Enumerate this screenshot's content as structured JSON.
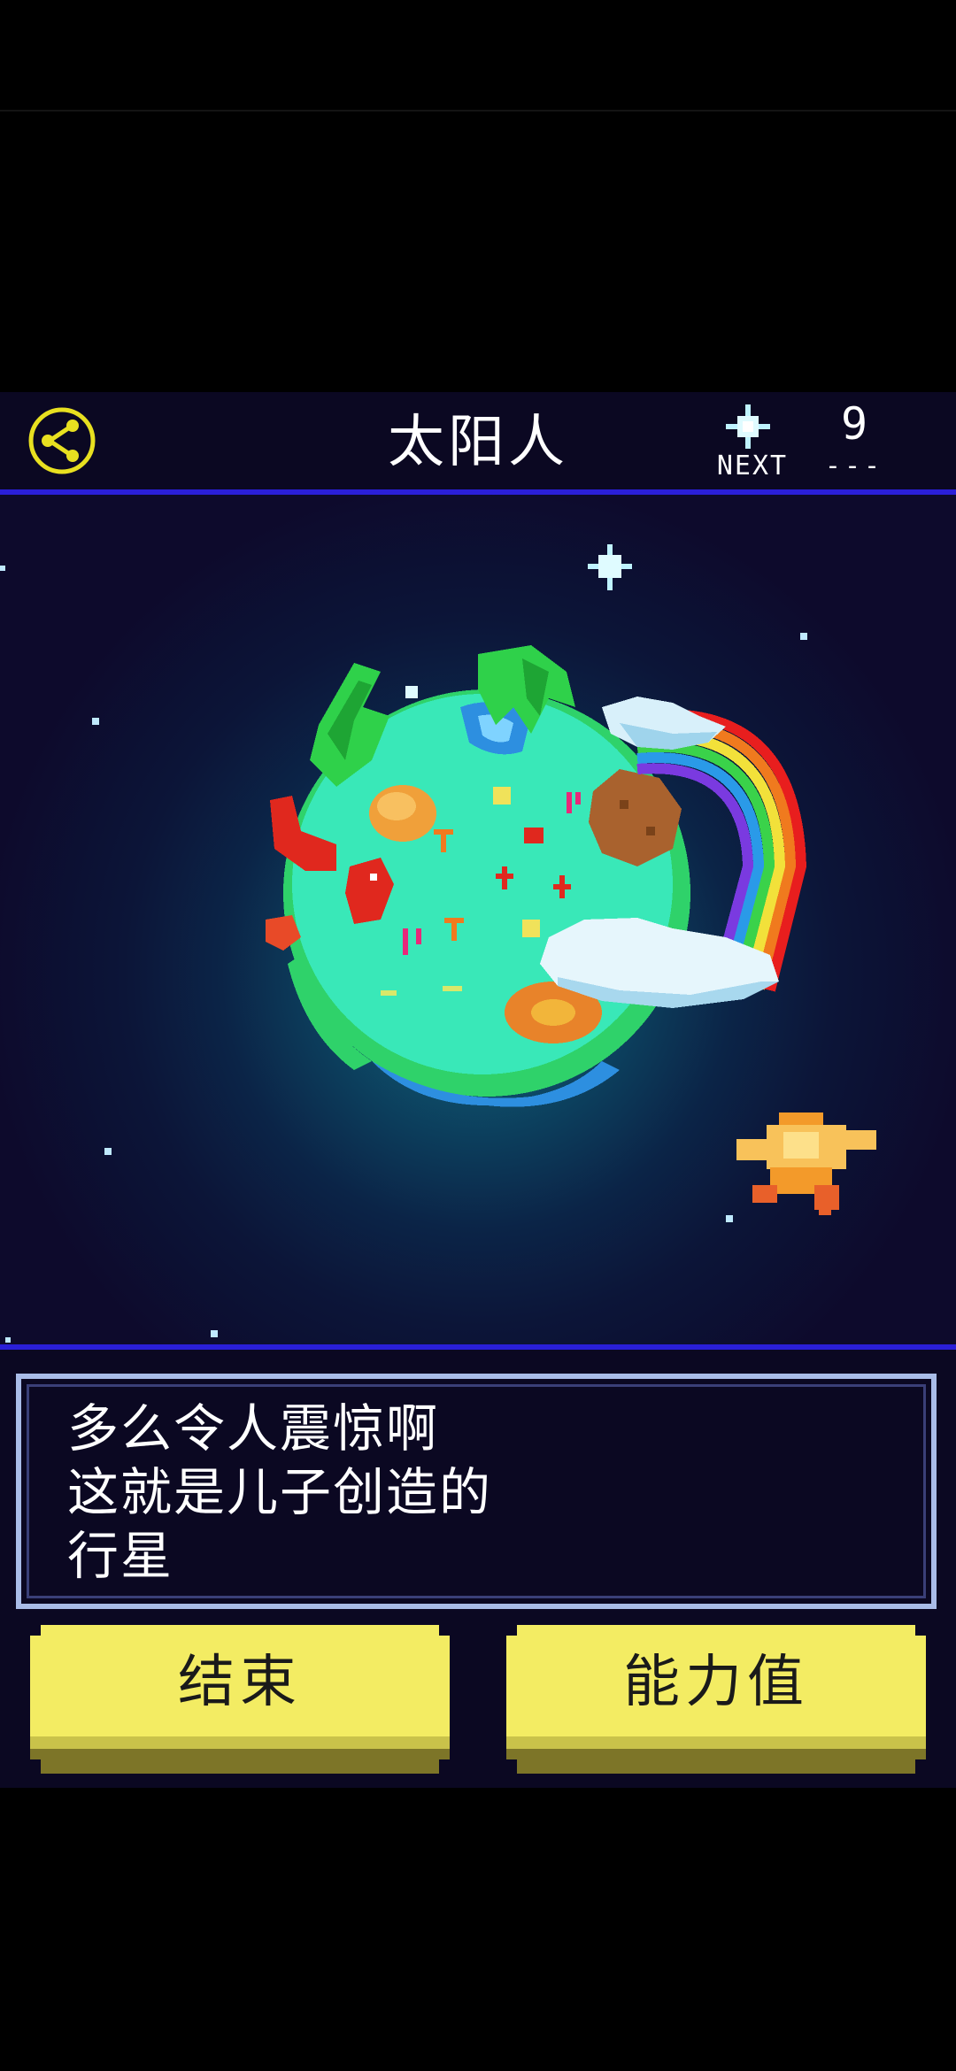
{
  "header": {
    "planet_name": "太阳人",
    "next_label": "NEXT",
    "next_count": "9",
    "next_dashes": "---"
  },
  "dialog": {
    "lines": [
      "多么令人震惊啊",
      "这就是儿子创造的",
      "行星"
    ]
  },
  "buttons": {
    "end_label": "结束",
    "stats_label": "能力值"
  },
  "colors": {
    "header_bg": "#0b0822",
    "divider": "#2a1fd8",
    "button_yellow": "#f3ec63",
    "share_icon": "#e8e020",
    "dialog_border": "#a9bce8"
  },
  "icons": {
    "share": "share-icon",
    "next_star": "sparkle-star-icon"
  }
}
